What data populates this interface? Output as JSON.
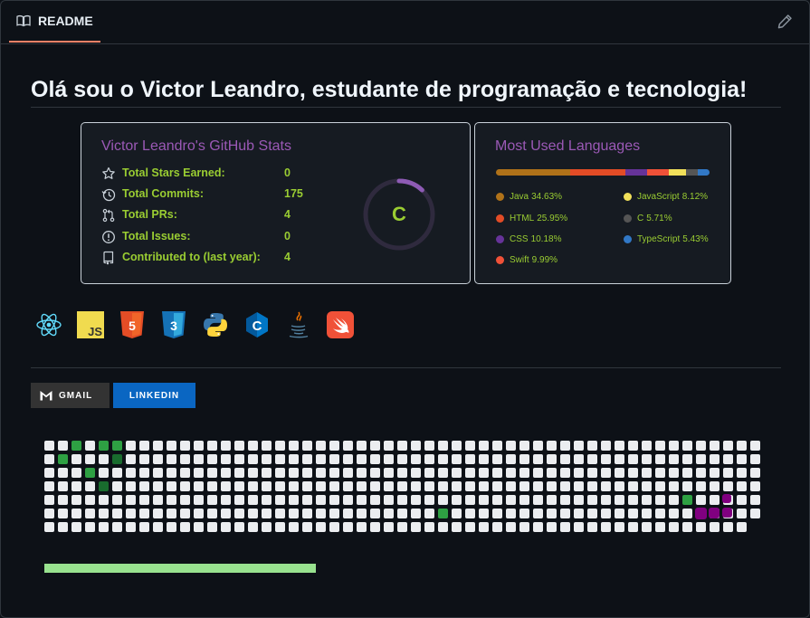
{
  "tab": {
    "label": "README",
    "book_icon": "book-icon",
    "edit_icon": "pencil-icon"
  },
  "heading": "Olá sou o Victor Leandro, estudante de programação e tecnologia!",
  "stats_card": {
    "title": "Victor Leandro's GitHub Stats",
    "rows": [
      {
        "icon": "star-icon",
        "label": "Total Stars Earned:",
        "value": "0"
      },
      {
        "icon": "history-icon",
        "label": "Total Commits:",
        "value": "175"
      },
      {
        "icon": "pull-request-icon",
        "label": "Total PRs:",
        "value": "4"
      },
      {
        "icon": "issue-icon",
        "label": "Total Issues:",
        "value": "0"
      },
      {
        "icon": "repo-icon",
        "label": "Contributed to (last year):",
        "value": "4"
      }
    ],
    "grade": "C",
    "grade_progress": 0.12,
    "colors": {
      "title": "#9b59b6",
      "text": "#9acd32",
      "ring": "#2f2a3e",
      "ring_progress": "#8e5bb5"
    }
  },
  "languages_card": {
    "title": "Most Used Languages",
    "languages": [
      {
        "name": "Java",
        "percent": "34.63%",
        "value": 34.63,
        "color": "#b07219"
      },
      {
        "name": "HTML",
        "percent": "25.95%",
        "value": 25.95,
        "color": "#e34c26"
      },
      {
        "name": "CSS",
        "percent": "10.18%",
        "value": 10.18,
        "color": "#663399"
      },
      {
        "name": "Swift",
        "percent": "9.99%",
        "value": 9.99,
        "color": "#f05138"
      },
      {
        "name": "JavaScript",
        "percent": "8.12%",
        "value": 8.12,
        "color": "#f1e05a"
      },
      {
        "name": "C",
        "percent": "5.71%",
        "value": 5.71,
        "color": "#555555"
      },
      {
        "name": "TypeScript",
        "percent": "5.43%",
        "value": 5.43,
        "color": "#3178c6"
      }
    ]
  },
  "tech_icons": [
    "react-icon",
    "javascript-icon",
    "html5-icon",
    "css3-icon",
    "python-icon",
    "c-language-icon",
    "java-icon",
    "swift-icon"
  ],
  "badges": {
    "gmail": "GMAIL",
    "linkedin": "LINKEDIN"
  },
  "snake": {
    "cell_color": "#ebedf0",
    "green_light": "#2ea043",
    "green_dark": "#196c2e",
    "snake_color": "#800080",
    "progress_color": "#98e28f"
  }
}
